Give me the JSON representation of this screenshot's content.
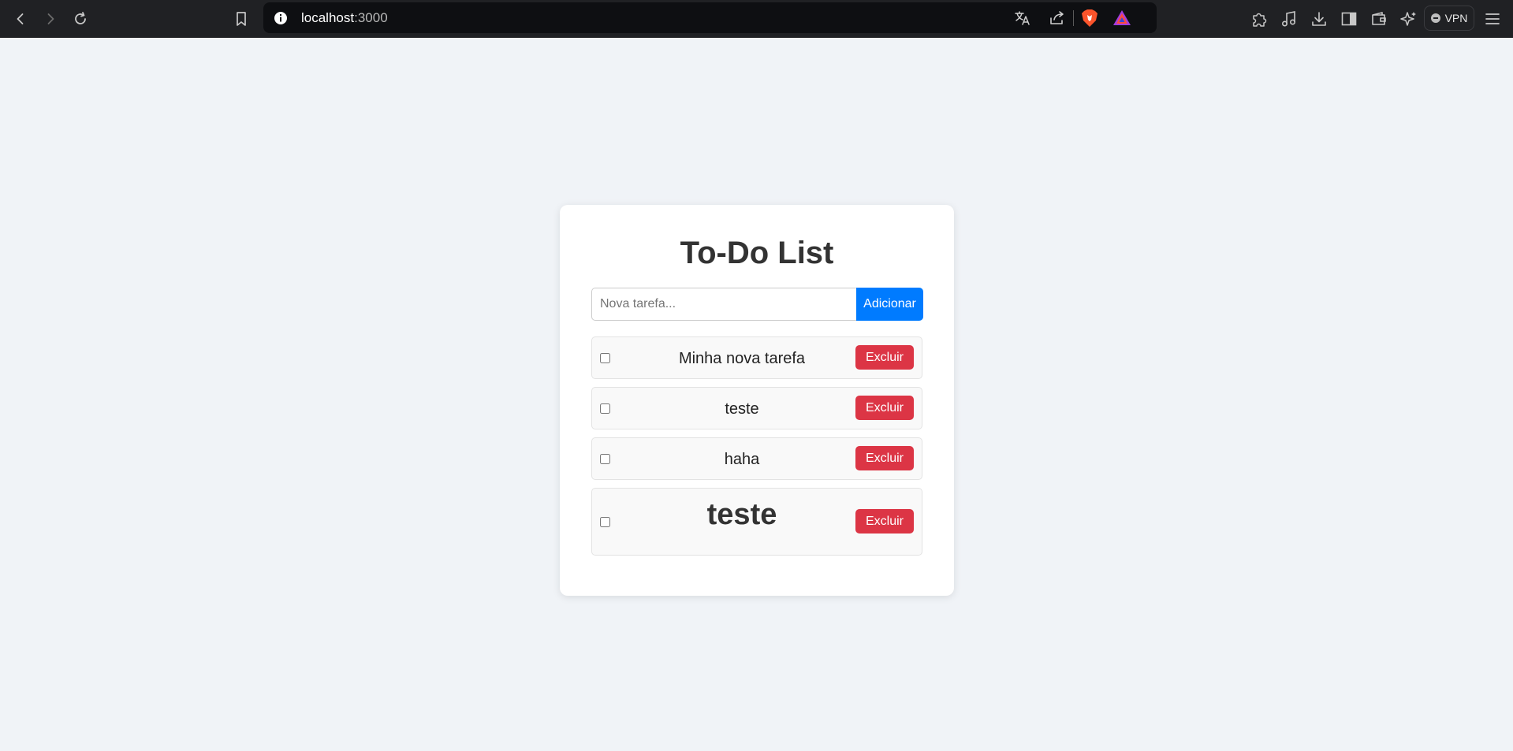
{
  "browser": {
    "url_host": "localhost",
    "url_port": ":3000",
    "vpn_label": "VPN",
    "colors": {
      "toolbar": "#202124",
      "url_bar": "#0e0f12"
    },
    "icons": [
      "back-icon",
      "forward-icon",
      "reload-icon",
      "bookmark-icon",
      "site-info-icon",
      "translate-icon",
      "share-icon",
      "brave-shields-icon",
      "brave-rewards-icon",
      "extensions-icon",
      "media-icon",
      "downloads-icon",
      "sidebar-icon",
      "wallet-icon",
      "leo-ai-icon",
      "vpn-icon",
      "menu-icon"
    ]
  },
  "app": {
    "title": "To-Do List",
    "input": {
      "placeholder": "Nova tarefa...",
      "value": ""
    },
    "add_button_label": "Adicionar",
    "tasks": [
      {
        "text": "Minha nova tarefa",
        "checked": false,
        "delete_label": "Excluir"
      },
      {
        "text": "teste",
        "checked": false,
        "delete_label": "Excluir"
      },
      {
        "text": "haha",
        "checked": false,
        "delete_label": "Excluir"
      },
      {
        "text": "teste",
        "checked": false,
        "delete_label": "Excluir"
      }
    ],
    "colors": {
      "background": "#f0f3f7",
      "primary": "#007bff",
      "danger": "#dc3545",
      "card": "#ffffff",
      "task_bg": "#f9f9f9"
    }
  }
}
